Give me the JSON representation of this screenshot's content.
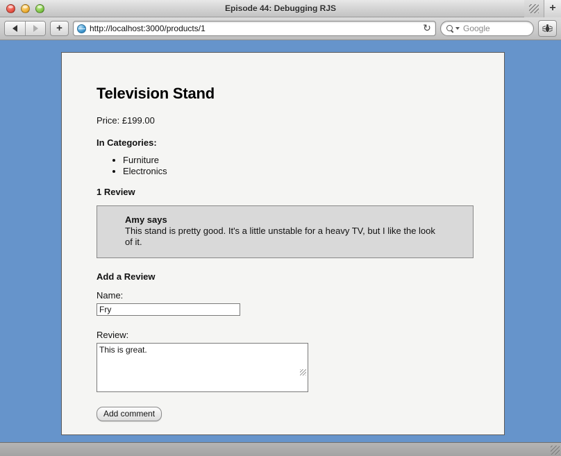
{
  "window": {
    "title": "Episode 44: Debugging RJS",
    "traffic_lights": {
      "close_label": "close",
      "minimize_label": "minimize",
      "zoom_label": "zoom"
    },
    "tab_overflow_icon": "tab-overflow-icon",
    "new_tab_label": "+"
  },
  "toolbar": {
    "back_icon": "back-arrow-icon",
    "forward_icon": "forward-arrow-icon",
    "add_label": "+",
    "favicon": "globe-icon",
    "url": "http://localhost:3000/products/1",
    "reload_icon": "↻",
    "search_placeholder": "Google",
    "search_value": "",
    "search_icon": "magnifier-icon",
    "debug_icon": "bug-icon"
  },
  "page": {
    "title": "Television Stand",
    "price_label": "Price:",
    "price_value": "£199.00",
    "price_line": "Price: £199.00",
    "categories_heading": "In Categories:",
    "categories": [
      "Furniture",
      "Electronics"
    ],
    "reviews_heading": "1 Review",
    "reviews": [
      {
        "author_line": "Amy says",
        "author": "Amy",
        "body": "This stand is pretty good. It's a little unstable for a heavy TV, but I like the look of it."
      }
    ],
    "form": {
      "heading": "Add a Review",
      "name_label": "Name:",
      "name_value": "Fry",
      "review_label": "Review:",
      "review_value": "This is great.",
      "submit_label": "Add comment"
    }
  },
  "colors": {
    "page_background": "#6694cb",
    "card_background": "#f5f5f3",
    "review_background": "#d9d9d9",
    "review_border": "#888888",
    "text": "#111111"
  }
}
